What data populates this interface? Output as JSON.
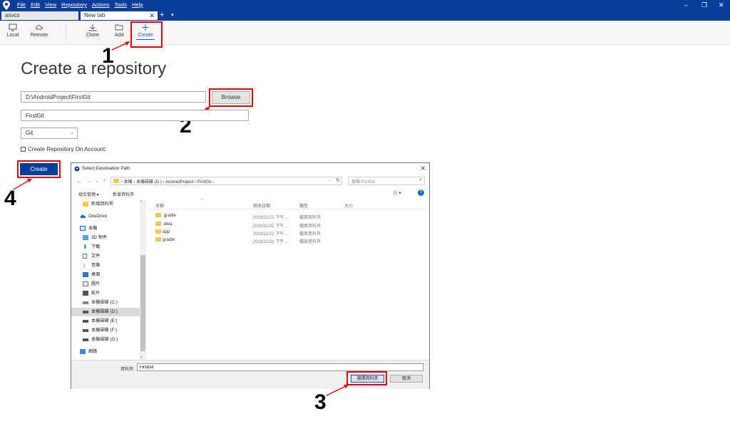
{
  "menu": [
    "File",
    "Edit",
    "View",
    "Repository",
    "Actions",
    "Tools",
    "Help"
  ],
  "window_controls": {
    "minimize": "–",
    "restore": "❐",
    "close": "✕"
  },
  "tabs": [
    {
      "label": "asvcs"
    },
    {
      "label": "New tab"
    }
  ],
  "tab_add": "+",
  "tab_dropdown": "▾",
  "toolbar": {
    "local": "Local",
    "remote": "Remote",
    "clone": "Clone",
    "add": "Add",
    "create": "Create"
  },
  "main": {
    "heading": "Create a repository",
    "path_value": "D:\\AndroidProject\\FirstGit",
    "browse_label": "Browse",
    "name_value": "FirstGit",
    "type_value": "Git",
    "account_label": "Create Repository On Account:",
    "create_label": "Create"
  },
  "annotations": [
    "1",
    "2",
    "3",
    "4"
  ],
  "dialog": {
    "title": "Select Destination Path",
    "close": "✕",
    "breadcrumb": [
      "本機",
      "本機磁碟 (D:)",
      "AndroidProject",
      "FirstGit"
    ],
    "search_placeholder": "搜尋 FirstGit",
    "organize": "組合管理 ▾",
    "new_folder": "新增資料夾",
    "columns": [
      "名稱",
      "修改日期",
      "類型",
      "大小"
    ],
    "nav": [
      {
        "label": "新增資料夾",
        "icon": "folder-icon"
      },
      {
        "label": "OneDrive",
        "icon": "cloud-icon"
      },
      {
        "label": "本機",
        "icon": "computer-icon"
      },
      {
        "label": "3D 物件",
        "icon": "cube-icon"
      },
      {
        "label": "下載",
        "icon": "download-icon"
      },
      {
        "label": "文件",
        "icon": "document-icon"
      },
      {
        "label": "音樂",
        "icon": "music-icon"
      },
      {
        "label": "桌面",
        "icon": "desktop-icon"
      },
      {
        "label": "圖片",
        "icon": "picture-icon"
      },
      {
        "label": "影片",
        "icon": "video-icon"
      },
      {
        "label": "本機磁碟 (C:)",
        "icon": "drive-icon"
      },
      {
        "label": "本機磁碟 (D:)",
        "icon": "drive-icon"
      },
      {
        "label": "本機磁碟 (E:)",
        "icon": "drive-icon"
      },
      {
        "label": "本機磁碟 (F:)",
        "icon": "drive-icon"
      },
      {
        "label": "本機磁碟 (G:)",
        "icon": "drive-icon"
      },
      {
        "label": "網路",
        "icon": "network-icon"
      }
    ],
    "files": [
      {
        "name": ".gradle",
        "date": "2019/11/21 下午 ...",
        "type": "檔案資料夾"
      },
      {
        "name": ".idea",
        "date": "2019/11/21 下午 ...",
        "type": "檔案資料夾"
      },
      {
        "name": "app",
        "date": "2019/11/21 下午 ...",
        "type": "檔案資料夾"
      },
      {
        "name": "gradle",
        "date": "2019/11/21 下午 ...",
        "type": "檔案資料夾"
      }
    ],
    "folder_label": "資料夾:",
    "folder_value": "FirstGit",
    "select_label": "選擇資料夾",
    "cancel_label": "取消"
  },
  "colors": {
    "titlebar": "#0b3e9b",
    "primary_button": "#0b3e9b",
    "annotation": "#e00000"
  }
}
